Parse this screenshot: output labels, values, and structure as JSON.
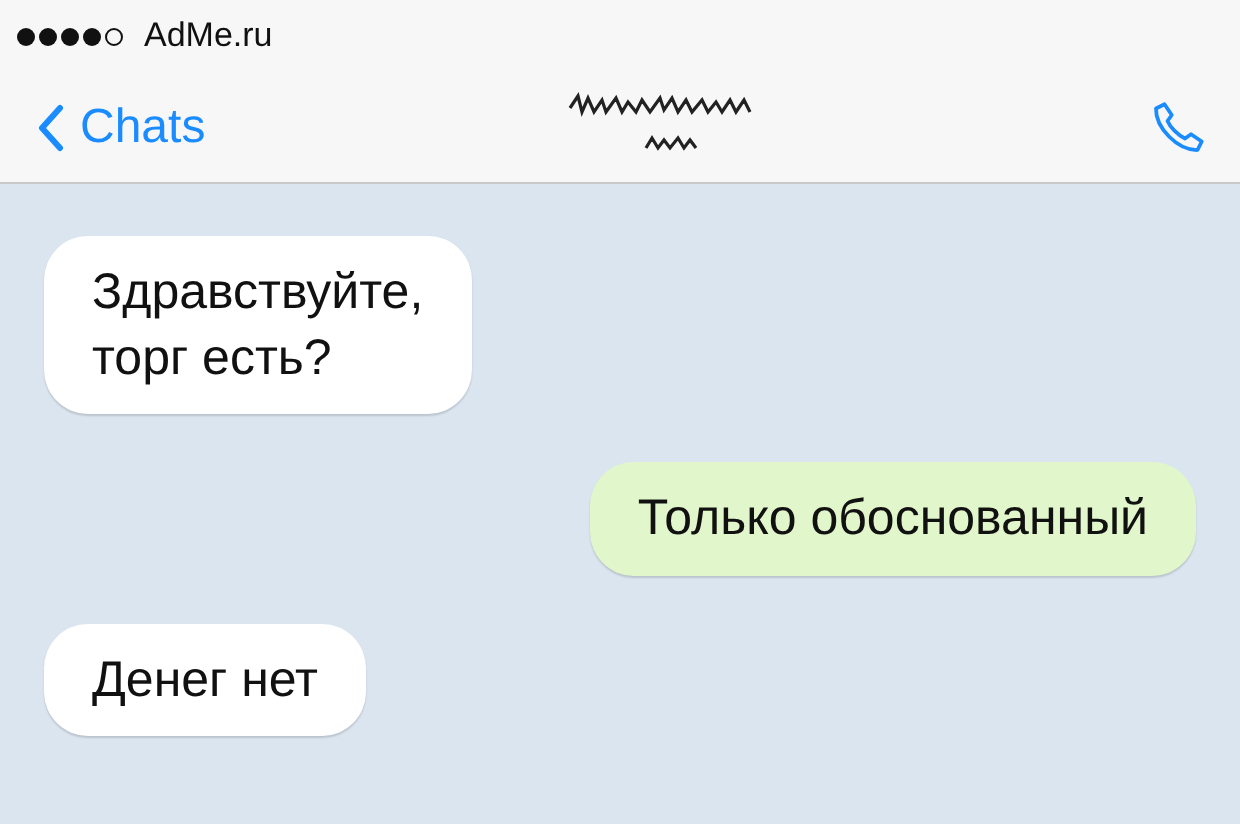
{
  "status_bar": {
    "carrier": "AdMe.ru"
  },
  "nav": {
    "back_label": "Chats"
  },
  "messages": [
    {
      "kind": "incoming",
      "text": "Здравствуйте,\nторг есть?"
    },
    {
      "kind": "outgoing",
      "text": "Только обоснованный"
    },
    {
      "kind": "incoming",
      "text": "Денег нет"
    }
  ]
}
